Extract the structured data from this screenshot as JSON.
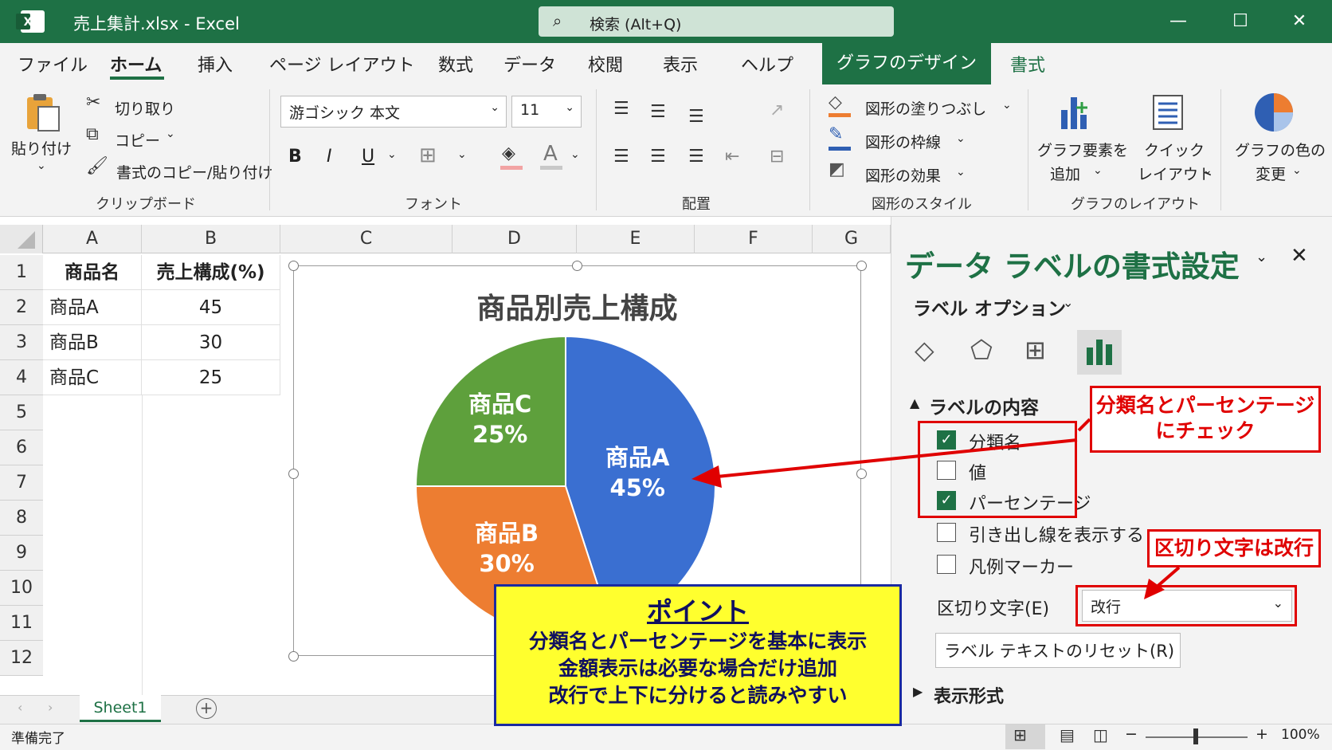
{
  "window": {
    "title": "売上集計.xlsx - Excel",
    "search": "検索 (Alt+Q)"
  },
  "tabs": [
    "ファイル",
    "ホーム",
    "挿入",
    "ページ レイアウト",
    "数式",
    "データ",
    "校閲",
    "表示",
    "ヘルプ",
    "グラフのデザイン",
    "書式"
  ],
  "ribbon": {
    "clipboard": {
      "paste": "貼り付け",
      "cut": "切り取り",
      "copy": "コピー",
      "format_painter": "書式のコピー/貼り付け",
      "label": "クリップボード"
    },
    "font": {
      "name": "游ゴシック 本文",
      "size": "11",
      "bold": "B",
      "italic": "I",
      "underline": "U",
      "font_color": "A",
      "label": "フォント"
    },
    "alignment": {
      "label": "配置"
    },
    "shape_styles": {
      "fill": "図形の塗りつぶし",
      "outline": "図形の枠線",
      "effects": "図形の効果",
      "label": "図形のスタイル"
    },
    "chart_layouts": {
      "add_element": [
        "グラフ要素を",
        "追加"
      ],
      "quick_layout": [
        "クイック",
        "レイアウト"
      ],
      "label": "グラフのレイアウト"
    },
    "chart_colors": [
      "グラフの色の",
      "変更"
    ]
  },
  "sheet": {
    "columns": [
      "A",
      "B",
      "C",
      "D",
      "E",
      "F",
      "G"
    ],
    "rows": [
      "1",
      "2",
      "3",
      "4",
      "5",
      "6",
      "7",
      "8",
      "9",
      "10",
      "11",
      "12"
    ],
    "header": [
      "商品名",
      "売上構成(%)"
    ],
    "data": [
      [
        "商品A",
        "45"
      ],
      [
        "商品B",
        "30"
      ],
      [
        "商品C",
        "25"
      ]
    ],
    "tab": "Sheet1"
  },
  "chart_data": {
    "type": "pie",
    "title": "商品別売上構成",
    "categories": [
      "商品A",
      "商品B",
      "商品C"
    ],
    "values": [
      45,
      30,
      25
    ],
    "labels": [
      "45%",
      "30%",
      "25%"
    ],
    "colors": [
      "#3a6fd1",
      "#ed7d31",
      "#5ea03c"
    ]
  },
  "pane": {
    "title": "データ ラベルの書式設定",
    "subtitle": "ラベル オプション",
    "section": "ラベルの内容",
    "options": [
      {
        "label": "分類名",
        "checked": true
      },
      {
        "label": "値",
        "checked": false
      },
      {
        "label": "パーセンテージ",
        "checked": true
      },
      {
        "label": "引き出し線を表示する",
        "checked": false
      },
      {
        "label": "凡例マーカー",
        "checked": false
      }
    ],
    "separator_label": "区切り文字(E)",
    "separator_value": "改行",
    "reset_button": "ラベル テキストのリセット(R)",
    "number_format": "表示形式"
  },
  "annotations": {
    "callout1": [
      "分類名とパーセンテージ",
      "にチェック"
    ],
    "callout2": "区切り文字は改行",
    "point_title": "ポイント",
    "point_lines": [
      "分類名とパーセンテージを基本に表示",
      "金額表示は必要な場合だけ追加",
      "改行で上下に分けると読みやすい"
    ]
  },
  "status": {
    "ready": "準備完了",
    "zoom": "100%"
  }
}
